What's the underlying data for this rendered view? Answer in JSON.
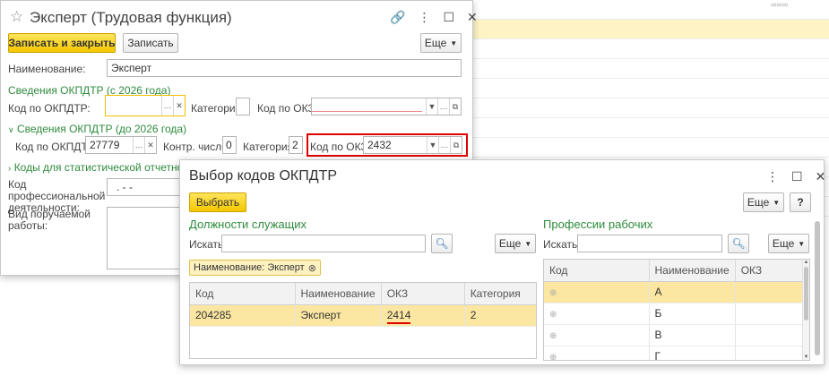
{
  "form": {
    "title": "Эксперт (Трудовая функция)",
    "save_close_label": "Записать и закрыть",
    "save_label": "Записать",
    "more_label": "Еще",
    "name_label": "Наименование:",
    "name_value": "Эксперт",
    "section_2026": "Сведения ОКПДТР (с 2026 года)",
    "okpdtr_label": "Код по ОКПДТР:",
    "okpdtr_value": "",
    "category_label": "Категория:",
    "category_value": "",
    "okz_label": "Код по ОКЗ:",
    "okz_value": "",
    "section_before": "Сведения ОКПДТР (до 2026 года)",
    "old_okpdtr_label": "Код по ОКПДТР:",
    "old_okpdtr_value": "27779",
    "check_label": "Контр. число:",
    "check_value": "0",
    "old_category_label": "Категория:",
    "old_category_value": "2",
    "old_okz_label": "Код по ОКЗ:",
    "old_okz_value": "2432",
    "section_stats": "Коды для статистической отчетности",
    "prof_label": "Код профессиональной деятельности:",
    "prof_value": ".  - -",
    "work_label": "Вид поручаемой работы:"
  },
  "dialog": {
    "title": "Выбор кодов ОКПДТР",
    "select_label": "Выбрать",
    "more_label": "Еще",
    "help_label": "?",
    "left": {
      "heading": "Должности служащих",
      "search_label": "Искать:",
      "search_value": "",
      "more_label": "Еще",
      "filter_chip": "Наименование: Эксперт",
      "columns": [
        "Код",
        "Наименование",
        "ОКЗ",
        "Категория"
      ],
      "rows": [
        {
          "code": "204285",
          "name": "Эксперт",
          "okz": "2414",
          "category": "2"
        }
      ]
    },
    "right": {
      "heading": "Профессии рабочих",
      "search_label": "Искать:",
      "search_value": "",
      "more_label": "Еще",
      "columns": [
        "Код",
        "Наименование",
        "ОКЗ"
      ],
      "rows": [
        {
          "code": "",
          "name": "А",
          "okz": ""
        },
        {
          "code": "",
          "name": "Б",
          "okz": ""
        },
        {
          "code": "",
          "name": "В",
          "okz": ""
        },
        {
          "code": "",
          "name": "Г",
          "okz": ""
        }
      ]
    }
  },
  "colors": {
    "accent_yellow": "#f4c800",
    "section_green": "#2e8b3c",
    "highlight_red": "#e00000",
    "selected_row": "#fbe7a1"
  }
}
